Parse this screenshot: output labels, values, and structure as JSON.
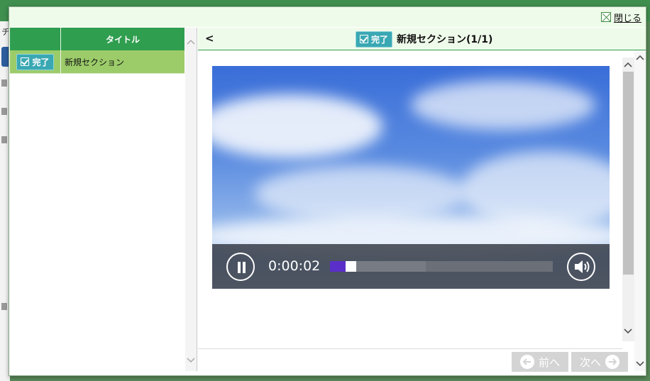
{
  "background": {
    "corner_glyph": "チ"
  },
  "dialog": {
    "close_label": "閉じる",
    "close_icon": "close-box-icon"
  },
  "list": {
    "header_title": "タイトル",
    "rows": [
      {
        "badge": "完了",
        "title": "新規セクション"
      }
    ]
  },
  "section": {
    "back_label": "<",
    "badge": "完了",
    "title": "新規セクション(1/1)"
  },
  "video": {
    "timecode": "0:00:02",
    "progress_played_fraction": 0.07,
    "progress_buffered_fraction": 0.43,
    "play_state_icon": "pause-icon",
    "volume_icon": "volume-icon"
  },
  "footer": {
    "prev_label": "前へ",
    "next_label": "次へ"
  },
  "colors": {
    "accent_green": "#2f9e4f",
    "row_selected": "#9ccc6a",
    "badge_teal": "#3aa8b3",
    "progress_played": "#5a2fc9"
  }
}
